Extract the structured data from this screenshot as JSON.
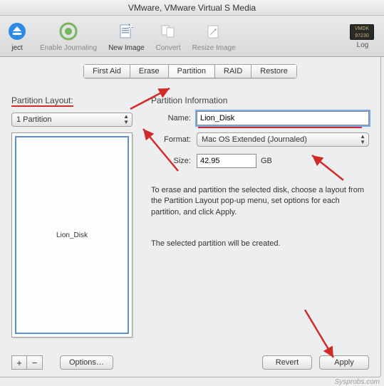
{
  "window": {
    "title": "VMware, VMware Virtual S Media"
  },
  "toolbar": {
    "eject": "ject",
    "journal": "Enable Journaling",
    "new_image": "New Image",
    "convert": "Convert",
    "resize": "Resize Image",
    "log": "Log"
  },
  "tabs": {
    "first_aid": "First Aid",
    "erase": "Erase",
    "partition": "Partition",
    "raid": "RAID",
    "restore": "Restore"
  },
  "left": {
    "section": "Partition Layout:",
    "layout_value": "1 Partition",
    "partition_name": "Lion_Disk"
  },
  "right": {
    "section": "Partition Information",
    "labels": {
      "name": "Name:",
      "format": "Format:",
      "size": "Size:"
    },
    "name_value": "Lion_Disk",
    "format_value": "Mac OS Extended (Journaled)",
    "size_value": "42.95",
    "size_unit": "GB",
    "info1": "To erase and partition the selected disk, choose a layout from the Partition Layout pop-up menu, set options for each partition, and click Apply.",
    "info2": "The selected partition will be created."
  },
  "buttons": {
    "options": "Options…",
    "revert": "Revert",
    "apply": "Apply",
    "plus": "+",
    "minus": "−"
  },
  "watermark": "Sysprobs.com"
}
